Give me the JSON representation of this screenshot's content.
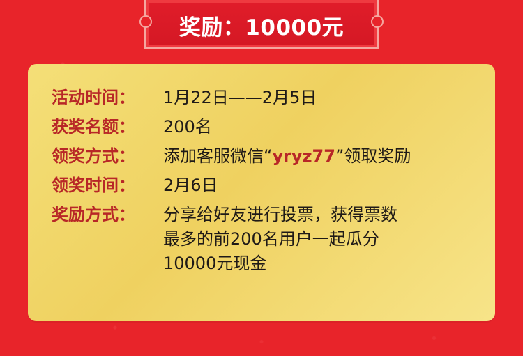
{
  "banner": {
    "title": "奖励：10000元"
  },
  "card": {
    "rows": [
      {
        "label": "活动时间：",
        "value": "1月22日——2月5日"
      },
      {
        "label": "获奖名额：",
        "value": "200名"
      },
      {
        "label": "领奖方式：",
        "value_before": "添加客服微信“",
        "value_highlight": "yryz77",
        "value_after": "”领取奖励"
      },
      {
        "label": "领奖时间：",
        "value": "2月6日"
      },
      {
        "label": "奖励方式：",
        "lines": [
          "分享给好友进行投票，获得票数",
          "最多的前200名用户一起瓜分",
          "10000元现金"
        ]
      }
    ]
  },
  "colors": {
    "background": "#e8242a",
    "card": "#f4df78",
    "label": "#b82727",
    "text": "#1f1a17"
  }
}
